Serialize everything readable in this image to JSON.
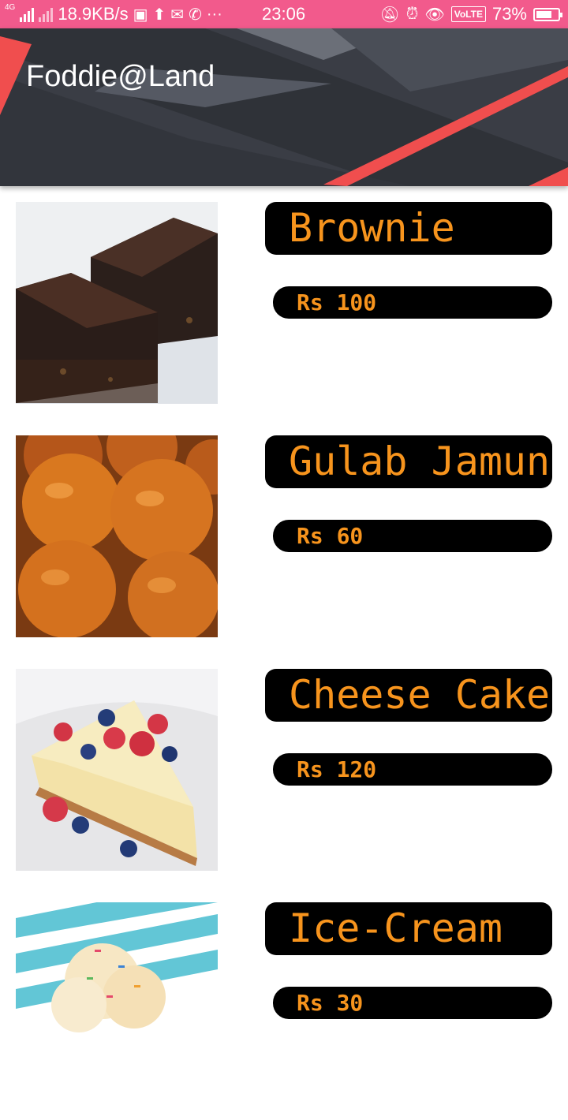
{
  "status_bar": {
    "network": "4G",
    "speed": "18.9KB/s",
    "time": "23:06",
    "network_type": "VoLTE",
    "battery": "73%",
    "battery_level": 0.73,
    "color": "#f25a8c"
  },
  "header": {
    "title": "Foddie@Land",
    "colors": {
      "bg": "#3a3d45",
      "accent": "#f04e4e"
    }
  },
  "items": [
    {
      "name": "Brownie",
      "price": "Rs 100",
      "image": "brownie"
    },
    {
      "name": "Gulab Jamun",
      "price": "Rs 60",
      "image": "gulab-jamun"
    },
    {
      "name": "Cheese Cake",
      "price": "Rs 120",
      "image": "cheese-cake"
    },
    {
      "name": "Ice-Cream",
      "price": "Rs 30",
      "image": "ice-cream"
    }
  ],
  "colors": {
    "pill_bg": "#000000",
    "pill_text": "#f7941d"
  }
}
